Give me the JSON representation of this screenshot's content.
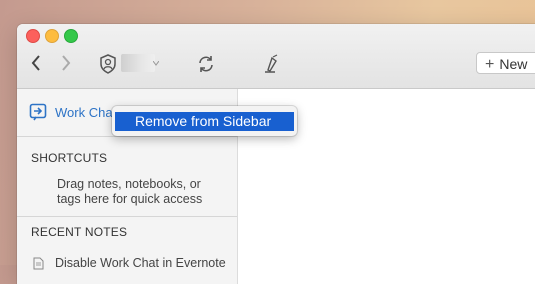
{
  "toolbar": {
    "back_icon": "chevron-left",
    "forward_icon": "chevron-right",
    "account_icon": "account-shield",
    "sync_icon": "sync-arrows",
    "work_chat_icon": "flag-rocket",
    "new_button_label": "New"
  },
  "sidebar": {
    "work_chat_label": "Work Chat",
    "shortcuts_title": "SHORTCUTS",
    "shortcuts_help": "Drag notes, notebooks, or tags here for quick access",
    "recent_notes_title": "RECENT NOTES",
    "recent_notes": [
      {
        "label": "Disable Work Chat in Evernote"
      }
    ]
  },
  "context_menu": {
    "items": [
      {
        "label": "Remove from Sidebar",
        "highlighted": true
      }
    ]
  },
  "colors": {
    "accent_blue": "#2d73c6",
    "menu_highlight": "#1860d0",
    "traffic_red": "#fc605c",
    "traffic_yellow": "#fdbc40",
    "traffic_green": "#34c84a"
  }
}
